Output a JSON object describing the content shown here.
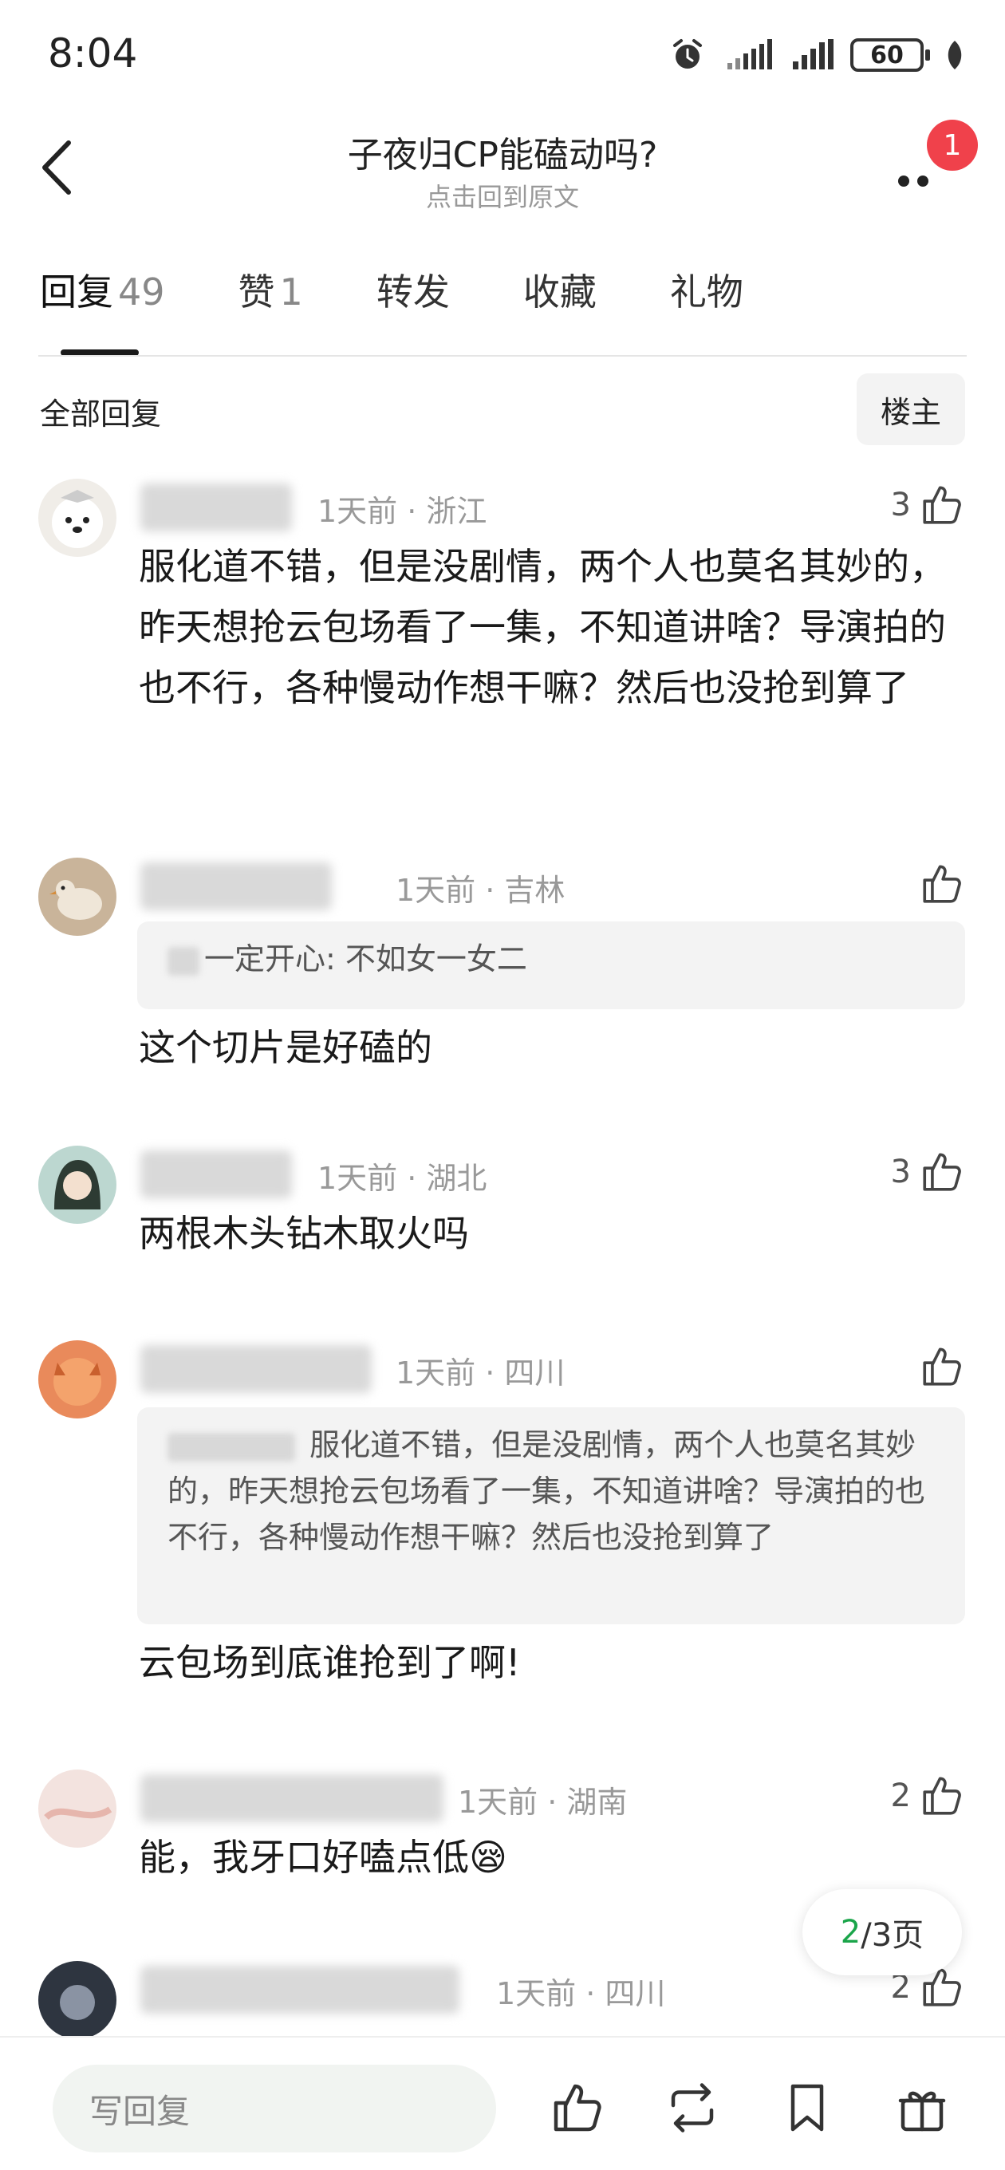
{
  "status_bar": {
    "time": "8:04",
    "battery": "60"
  },
  "header": {
    "title": "子夜归CP能磕动吗?",
    "subtitle": "点击回到原文",
    "notification_count": "1"
  },
  "tabs": [
    {
      "label": "回复",
      "count": "49"
    },
    {
      "label": "赞",
      "count": "1"
    },
    {
      "label": "转发",
      "count": ""
    },
    {
      "label": "收藏",
      "count": ""
    },
    {
      "label": "礼物",
      "count": ""
    }
  ],
  "filter": {
    "all_replies": "全部回复",
    "op_only": "楼主"
  },
  "comments": [
    {
      "time_location": "1天前 · 浙江",
      "likes": "3",
      "quote": "",
      "text": "服化道不错，但是没剧情，两个人也莫名其妙的，昨天想抢云包场看了一集，不知道讲啥？导演拍的也不行，各种慢动作想干嘛？然后也没抢到算了"
    },
    {
      "time_location": "1天前 · 吉林",
      "likes": "",
      "quote": "不如女一女二",
      "quote_prefix": "一定开心:",
      "text": "这个切片是好磕的"
    },
    {
      "time_location": "1天前 · 湖北",
      "likes": "3",
      "quote": "",
      "text": "两根木头钻木取火吗"
    },
    {
      "time_location": "1天前 · 四川",
      "likes": "",
      "quote": "服化道不错，但是没剧情，两个人也莫名其妙的，昨天想抢云包场看了一集，不知道讲啥？导演拍的也不行，各种慢动作想干嘛？然后也没抢到算了",
      "text": "云包场到底谁抢到了啊!"
    },
    {
      "time_location": "1天前 · 湖南",
      "likes": "2",
      "quote": "",
      "text": "能，我牙口好嗑点低",
      "emoji": "😪"
    },
    {
      "time_location": "1天前 · 四川",
      "likes": "2",
      "quote": "",
      "text": ""
    }
  ],
  "pagination": {
    "current": "2",
    "total": "/3页"
  },
  "bottom_bar": {
    "reply_placeholder": "写回复",
    "icons": [
      "thumbs-up-icon",
      "repost-icon",
      "bookmark-icon",
      "gift-icon"
    ]
  },
  "colors": {
    "accent_green": "#1aa54a",
    "badge_red": "#f0414b",
    "meta_gray": "#999999"
  }
}
